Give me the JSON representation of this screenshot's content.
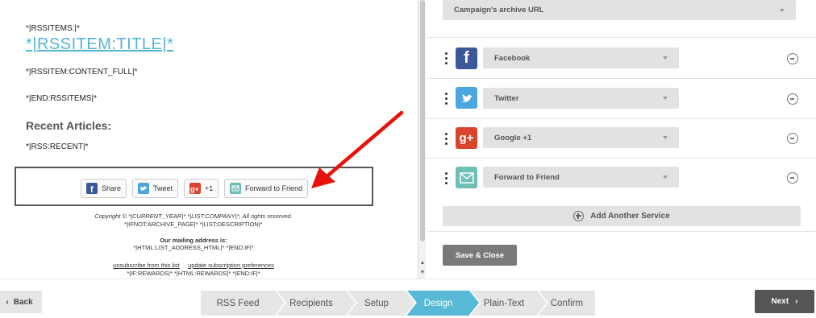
{
  "preview": {
    "rss_items_open": "*|RSSITEMS:|*",
    "rss_item_title": "*|RSSITEM:TITLE|*",
    "rss_item_content": "*|RSSITEM:CONTENT_FULL|*",
    "rss_items_end": "*|END:RSSITEMS|*",
    "recent_heading": "Recent Articles:",
    "rss_recent": "*|RSS:RECENT|*",
    "share_buttons": [
      {
        "label": "Share",
        "icon": "facebook-icon",
        "color": "#3b5998"
      },
      {
        "label": "Tweet",
        "icon": "twitter-icon",
        "color": "#4ba6e0"
      },
      {
        "label": "+1",
        "icon": "google-plus-icon",
        "color": "#d9442f"
      },
      {
        "label": "Forward to Friend",
        "icon": "email-icon",
        "color": "#6dbfb5"
      }
    ],
    "footer": {
      "copyright": "Copyright © *|CURRENT_YEAR|* *|LIST:COMPANY|*, All rights reserved.",
      "archive_line": "*|IFNOT:ARCHIVE_PAGE|* *|LIST:DESCRIPTION|*",
      "address_heading": "Our mailing address is:",
      "address_line": "*|HTML:LIST_ADDRESS_HTML|* *|END:IF|*",
      "unsubscribe": "unsubscribe from this list",
      "update_prefs": "update subscription preferences",
      "rewards_line": "*|IF:REWARDS|* *|HTML:REWARDS|* *|END:IF|*"
    }
  },
  "settings": {
    "archive_select": "Campaign's archive URL",
    "services": [
      {
        "name": "Facebook",
        "icon": "facebook-icon",
        "color": "#3b5998"
      },
      {
        "name": "Twitter",
        "icon": "twitter-icon",
        "color": "#4ba6e0"
      },
      {
        "name": "Google +1",
        "icon": "google-plus-icon",
        "color": "#d9442f"
      },
      {
        "name": "Forward to Friend",
        "icon": "email-icon",
        "color": "#6dbfb5"
      }
    ],
    "add_service": "Add Another Service",
    "save_close": "Save & Close"
  },
  "nav": {
    "back": "Back",
    "next": "Next",
    "steps": [
      "RSS Feed",
      "Recipients",
      "Setup",
      "Design",
      "Plain-Text",
      "Confirm"
    ],
    "active_step": "Design"
  },
  "colors": {
    "accent": "#58b9d6",
    "link": "#56b3d4",
    "arrow": "#e8120c"
  }
}
